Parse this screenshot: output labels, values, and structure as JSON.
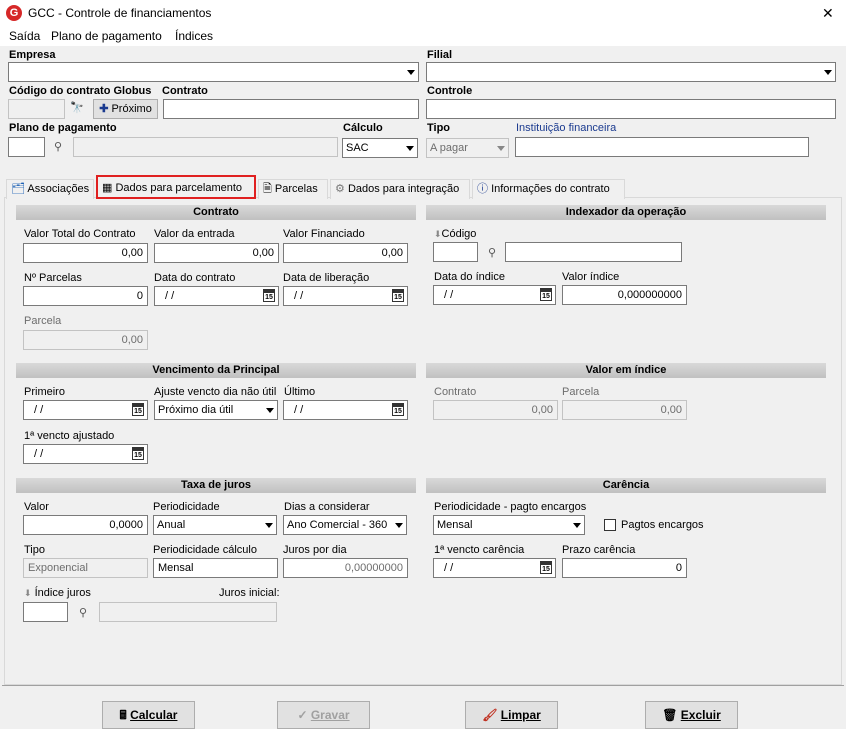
{
  "window": {
    "title": "GCC - Controle de financiamentos",
    "close": "✕"
  },
  "menu": [
    "Saída",
    "Plano de pagamento",
    "Índices"
  ],
  "header": {
    "empresa": "Empresa",
    "filial": "Filial",
    "codigo_contrato": "Código do contrato Globus",
    "contrato": "Contrato",
    "proximo": "Próximo",
    "controle": "Controle",
    "plano": "Plano de pagamento",
    "calculo": "Cálculo",
    "calculo_val": "SAC",
    "tipo": "Tipo",
    "tipo_val": "A pagar",
    "instituicao": "Instituição financeira"
  },
  "tabs": [
    "Associações",
    "Dados para parcelamento",
    "Parcelas",
    "Dados para integração",
    "Informações do contrato"
  ],
  "contrato": {
    "title": "Contrato",
    "valor_total": "Valor Total do Contrato",
    "valor_total_val": "0,00",
    "valor_entrada": "Valor da entrada",
    "valor_entrada_val": "0,00",
    "valor_fin": "Valor Financiado",
    "valor_fin_val": "0,00",
    "parcelas": "Nº Parcelas",
    "parcelas_val": "0",
    "data_contrato": "Data do contrato",
    "data_contrato_val": "/ /",
    "data_lib": "Data de liberação",
    "data_lib_val": "/ /",
    "parcela": "Parcela",
    "parcela_val": "0,00"
  },
  "indexador": {
    "title": "Indexador da operação",
    "codigo": "Código",
    "data_indice": "Data do índice",
    "data_indice_val": "/ /",
    "valor_indice": "Valor índice",
    "valor_indice_val": "0,000000000"
  },
  "vencimento": {
    "title": "Vencimento da Principal",
    "primeiro": "Primeiro",
    "primeiro_val": "/ /",
    "ajuste": "Ajuste vencto dia não útil",
    "ajuste_val": "Próximo dia útil",
    "ultimo": "Último",
    "ultimo_val": "/ /",
    "ajustado": "1ª vencto ajustado",
    "ajustado_val": "/ /"
  },
  "valor_indice": {
    "title": "Valor em índice",
    "contrato": "Contrato",
    "contrato_val": "0,00",
    "parcela": "Parcela",
    "parcela_val": "0,00"
  },
  "juros": {
    "title": "Taxa de juros",
    "valor": "Valor",
    "valor_val": "0,0000",
    "periodicidade": "Periodicidade",
    "periodicidade_val": "Anual",
    "dias": "Dias a considerar",
    "dias_val": "Ano Comercial - 360",
    "tipo": "Tipo",
    "tipo_val": "Exponencial",
    "per_calc": "Periodicidade cálculo",
    "per_calc_val": "Mensal",
    "juros_dia": "Juros por dia",
    "juros_dia_val": "0,00000000",
    "indice_juros": "Índice juros",
    "juros_inicial": "Juros inicial:"
  },
  "carencia": {
    "title": "Carência",
    "periodicidade": "Periodicidade - pagto encargos",
    "periodicidade_val": "Mensal",
    "pagtos": "Pagtos encargos",
    "vencto": "1ª vencto carência",
    "vencto_val": "/ /",
    "prazo": "Prazo carência",
    "prazo_val": "0"
  },
  "buttons": {
    "calcular": "Calcular",
    "gravar": "Gravar",
    "limpar": "Limpar",
    "excluir": "Excluir"
  }
}
